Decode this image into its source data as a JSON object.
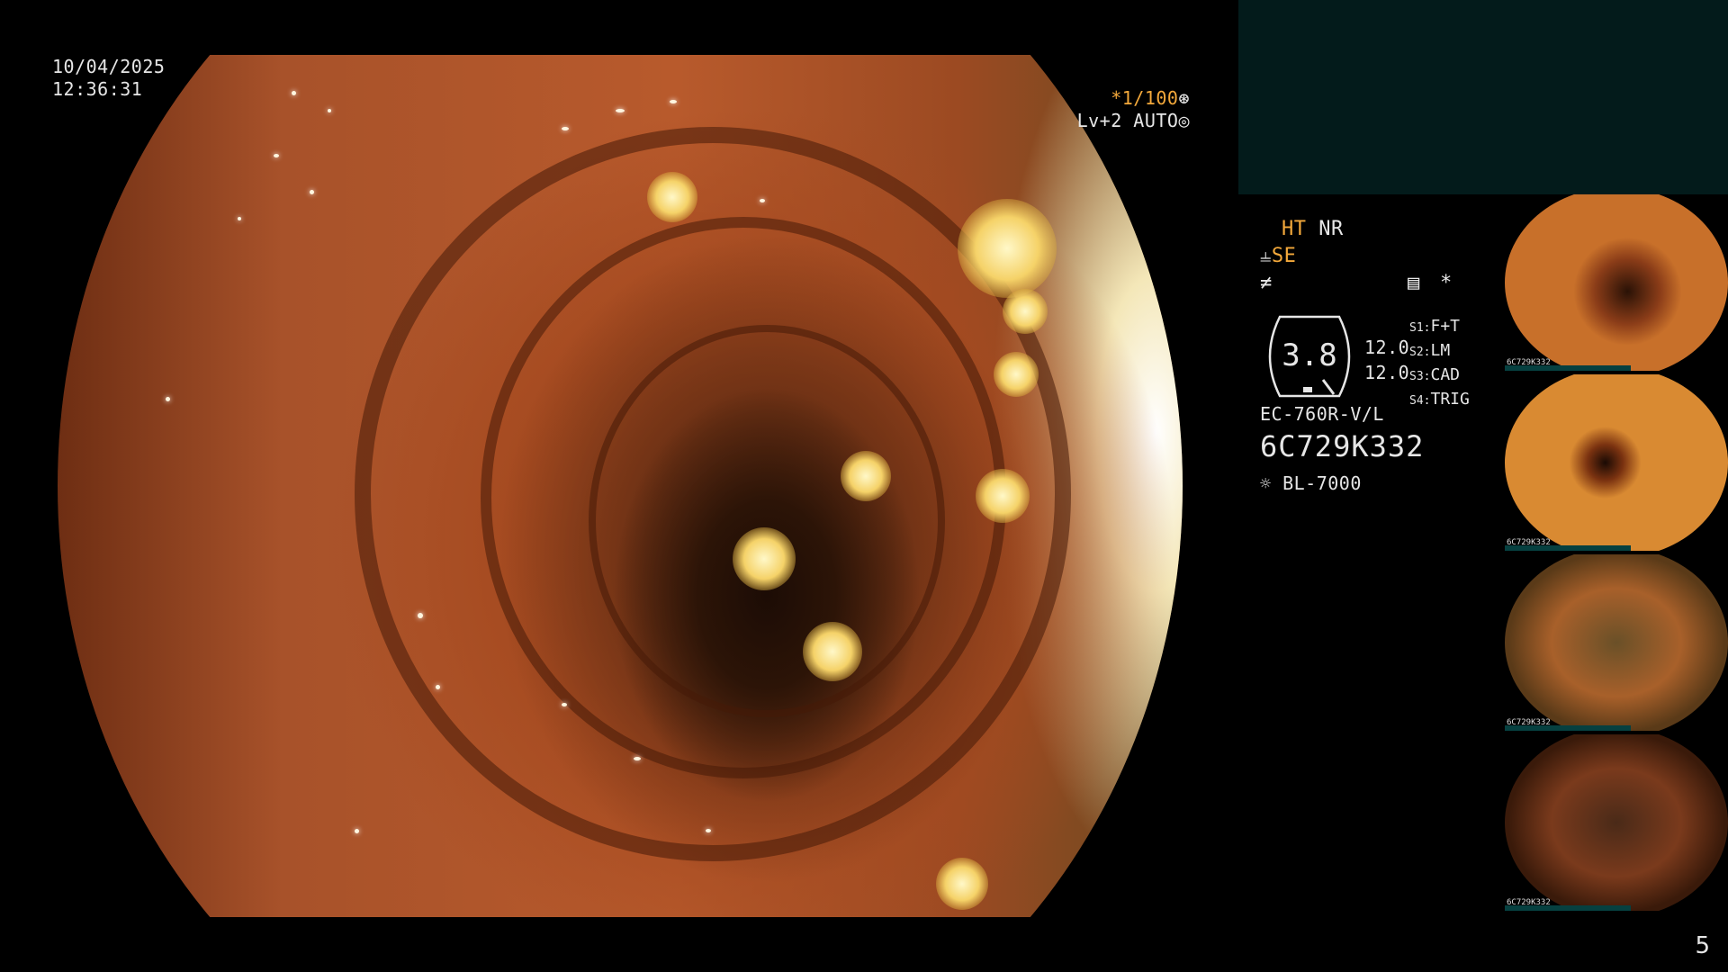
{
  "datetime": {
    "date": "10/04/2025",
    "time": "12:36:31"
  },
  "capture": {
    "shutter": "*1/100",
    "shutter_icon": "shutter-dial-icon",
    "level": "Lv+2 AUTO",
    "auto_icon": "auto-exposure-icon"
  },
  "status": {
    "ht": "HT",
    "nr": "NR",
    "se": "SE",
    "se_icon": "structure-enhance-icon",
    "flow_icon": "flow-icon",
    "memo_icon": "memo-icon",
    "star": "*"
  },
  "gauge": {
    "value": "3.8"
  },
  "readouts": [
    "12.0",
    "12.0"
  ],
  "slots": [
    {
      "key": "S1:",
      "val": "F+T"
    },
    {
      "key": "S2:",
      "val": "LM"
    },
    {
      "key": "S3:",
      "val": "CAD"
    },
    {
      "key": "S4:",
      "val": "TRIG"
    }
  ],
  "scope": {
    "model": "EC-760R-V/L",
    "serial": "6C729K332",
    "light_icon": "light-source-icon",
    "light": "BL-7000"
  },
  "thumbnails": [
    {
      "name": "thumbnail-1",
      "label": "6C729K332",
      "tint": "#c8702a"
    },
    {
      "name": "thumbnail-2",
      "label": "6C729K332",
      "tint": "#d98a32"
    },
    {
      "name": "thumbnail-3",
      "label": "6C729K332",
      "tint": "#a8602a"
    },
    {
      "name": "thumbnail-4",
      "label": "6C729K332",
      "tint": "#7a3a1c"
    }
  ],
  "page_number": "5",
  "colors": {
    "accent_orange": "#f4a93b",
    "panel_teal": "#031b1b",
    "text": "#e6e6e6"
  }
}
